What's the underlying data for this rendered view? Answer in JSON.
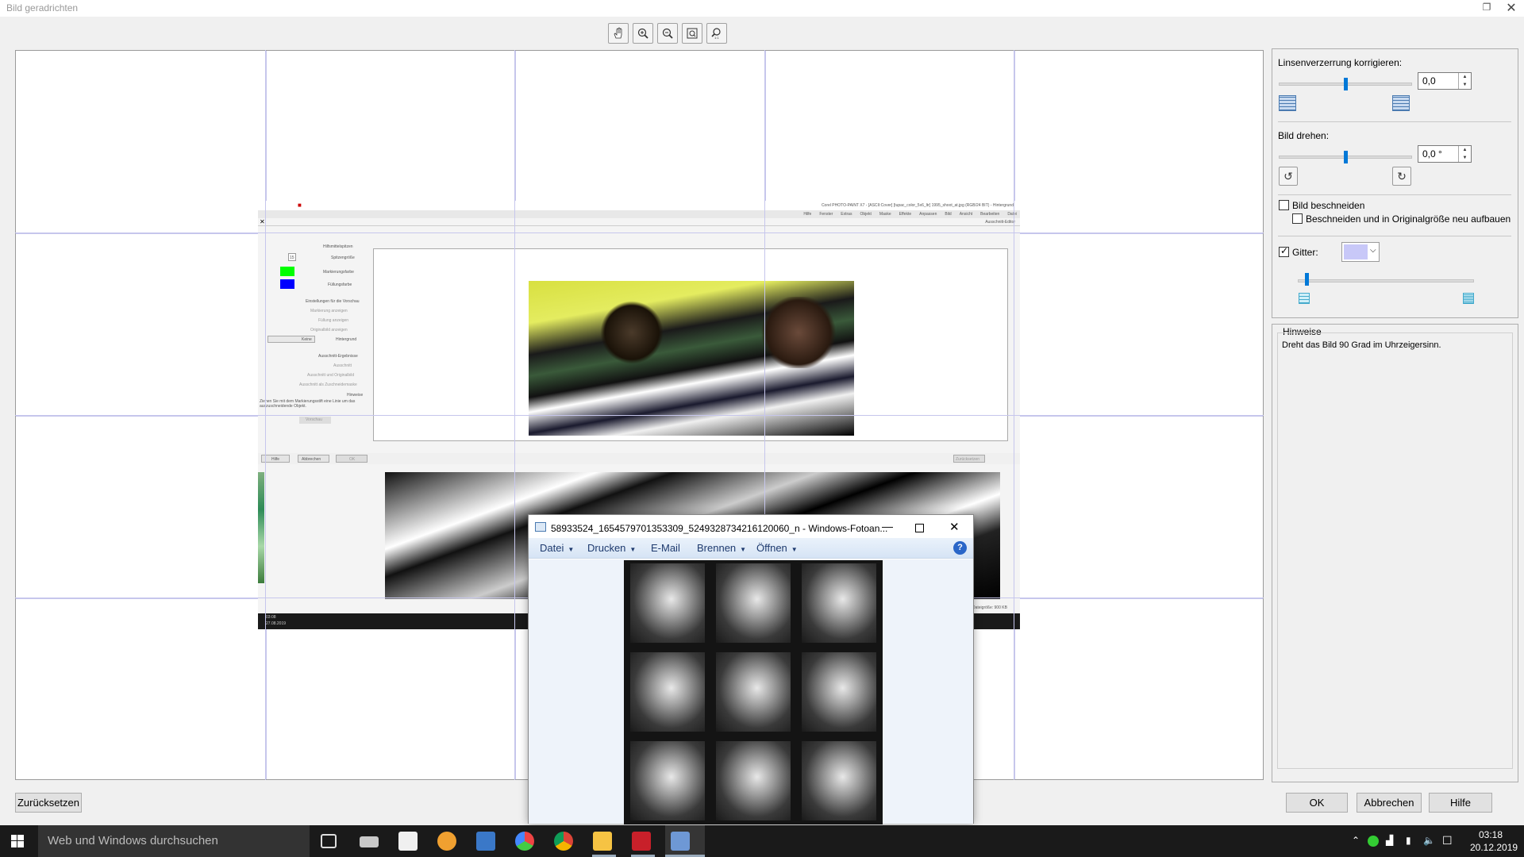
{
  "window": {
    "title": "Bild geradrichten"
  },
  "toolbar": {
    "tools": [
      {
        "name": "hand-tool"
      },
      {
        "name": "zoom-in"
      },
      {
        "name": "zoom-out"
      },
      {
        "name": "fit-to-window"
      },
      {
        "name": "zoom-100"
      }
    ]
  },
  "embedded_screenshot": {
    "app_title": "Corel PHOTO-PAINT X7 - [ASCII:Cover] [tupac_color_5x6_ltr] 1995_shoot_at.jpg (RGB/24 BIT) - Hintergrund",
    "menu": [
      "Datei",
      "Bearbeiten",
      "Ansicht",
      "Bild",
      "Anpassen",
      "Effekte",
      "Maske",
      "Objekt",
      "Extras",
      "Fenster",
      "Hilfe"
    ],
    "panel_title": "Ausschnitt-Editor",
    "tools_heading": "Hilfsmittelspitzen",
    "labels": [
      "Spitzengröße",
      "Markierungsfarbe",
      "Füllungsfarbe",
      "Einstellungen für die Vorschau",
      "Markierung anzeigen",
      "Füllung anzeigen",
      "Originalbild anzeigen",
      "Hintergrund",
      "Ausschnitt-Ergebnisse",
      "Ausschnitt",
      "Ausschnitt und Originalbild",
      "Ausschnitt als Zuschneidemaske",
      "Hinweise",
      "Ziehen Sie mit dem Markierungsstift eine Linie um das auszuschneidende Objekt."
    ],
    "brush_size": "15",
    "background_option": "Keine",
    "buttons": [
      "Hilfe",
      "Abbrechen",
      "OK",
      "Zurücksetzen",
      "Vorschau"
    ],
    "status": "Dateigröße: 900 KB",
    "clock": "03:08",
    "date": "27.08.2019"
  },
  "viewer": {
    "title": "58933524_1654579701353309_5249328734216120060_n - Windows-Fotoan...",
    "menu": [
      {
        "label": "Datei",
        "dropdown": true
      },
      {
        "label": "Drucken",
        "dropdown": true
      },
      {
        "label": "E-Mail",
        "dropdown": false
      },
      {
        "label": "Brennen",
        "dropdown": true
      },
      {
        "label": "Öffnen",
        "dropdown": true
      }
    ]
  },
  "right_panel": {
    "lens_label": "Linsenverzerrung korrigieren:",
    "lens_value": "0,0",
    "lens_slider": 0.5,
    "rotate_label": "Bild drehen:",
    "rotate_value": "0,0 °",
    "rotate_slider": 0.5,
    "crop_label": "Bild beschneiden",
    "crop_checked": false,
    "crop_rebuild_label": "Beschneiden und in Originalgröße neu aufbauen",
    "crop_rebuild_checked": false,
    "grid_label": "Gitter:",
    "grid_checked": true,
    "grid_color": "#c8c8f8",
    "grid_slider": 0.05,
    "hints_title": "Hinweise",
    "hints_text": "Dreht das Bild 90 Grad im Uhrzeigersinn."
  },
  "buttons": {
    "reset": "Zurücksetzen",
    "ok": "OK",
    "cancel": "Abbrechen",
    "help": "Hilfe"
  },
  "taskbar": {
    "search_placeholder": "Web und Windows durchsuchen",
    "time": "03:18",
    "date": "20.12.2019"
  }
}
